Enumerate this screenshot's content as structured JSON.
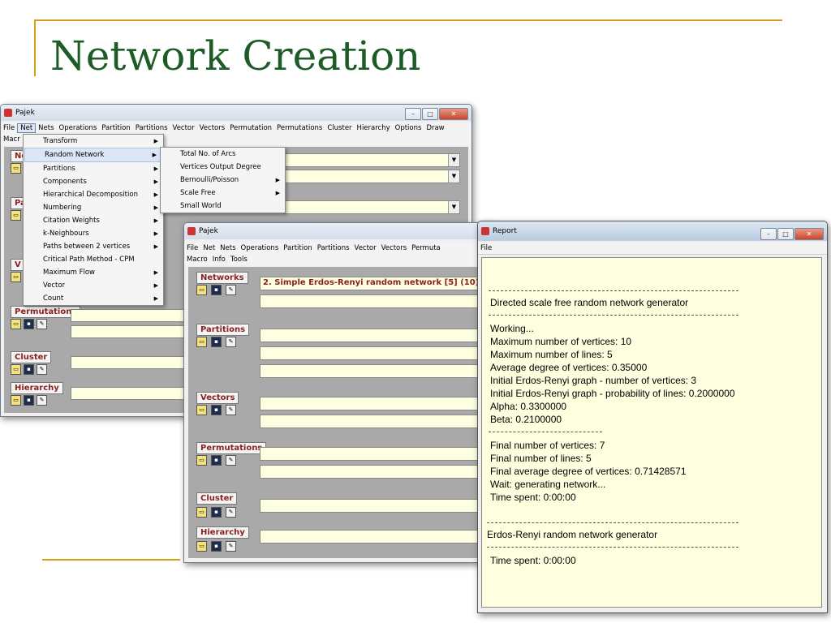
{
  "slide": {
    "title": "Network Creation"
  },
  "colors": {
    "accent_rule": "#d4a017",
    "title_green": "#1d5c27",
    "panel_label": "#8a1f1f",
    "field_yellow": "#fefee0"
  },
  "pajek_back": {
    "title": "Pajek",
    "menu": [
      "File",
      "Net",
      "Nets",
      "Operations",
      "Partition",
      "Partitions",
      "Vector",
      "Vectors",
      "Permutation",
      "Permutations",
      "Cluster",
      "Hierarchy",
      "Options",
      "Draw"
    ],
    "menu_row2": "Macr",
    "panels": {
      "permutations": "Permutations",
      "cluster": "Cluster",
      "hierarchy": "Hierarchy",
      "ne": "Ne",
      "pa": "Pa",
      "v": "V"
    },
    "net_menu": [
      "Transform",
      "Random Network",
      "Partitions",
      "Components",
      "Hierarchical Decomposition",
      "Numbering",
      "Citation Weights",
      "k-Neighbours",
      "Paths between 2 vertices",
      "Critical Path Method - CPM",
      "Maximum Flow",
      "Vector",
      "Count"
    ],
    "random_submenu": [
      "Total No. of Arcs",
      "Vertices Output Degree",
      "Bernoulli/Poisson",
      "Scale Free",
      "Small World"
    ]
  },
  "pajek_front": {
    "title": "Pajek",
    "menu": [
      "File",
      "Net",
      "Nets",
      "Operations",
      "Partition",
      "Partitions",
      "Vector",
      "Vectors",
      "Permuta"
    ],
    "menu_row2": [
      "Macro",
      "Info",
      "Tools"
    ],
    "panels": {
      "networks": "Networks",
      "partitions": "Partitions",
      "vectors": "Vectors",
      "permutations": "Permutations",
      "cluster": "Cluster",
      "hierarchy": "Hierarchy"
    },
    "selected_network": "2. Simple Erdos-Renyi random network [5] (10)"
  },
  "report": {
    "title": "Report",
    "menu": [
      "File"
    ],
    "lines": [
      "Directed scale free random network generator",
      "Working...",
      "Maximum number of vertices: 10",
      "Maximum number of lines: 5",
      "Average degree of vertices: 0.35000",
      "Initial Erdos-Renyi graph - number of vertices: 3",
      "Initial Erdos-Renyi graph - probability of lines: 0.2000000",
      "Alpha: 0.3300000",
      "Beta: 0.2100000",
      "Final number of vertices: 7",
      "Final number of lines: 5",
      "Final average degree of vertices: 0.71428571",
      "Wait: generating network...",
      "Time spent:  0:00:00",
      "Erdos-Renyi random network generator",
      "Time spent:  0:00:00"
    ]
  },
  "icons": {
    "app": "pajek-app-icon",
    "open": "folder-open-icon",
    "save": "floppy-save-icon",
    "edit": "edit-icon"
  }
}
